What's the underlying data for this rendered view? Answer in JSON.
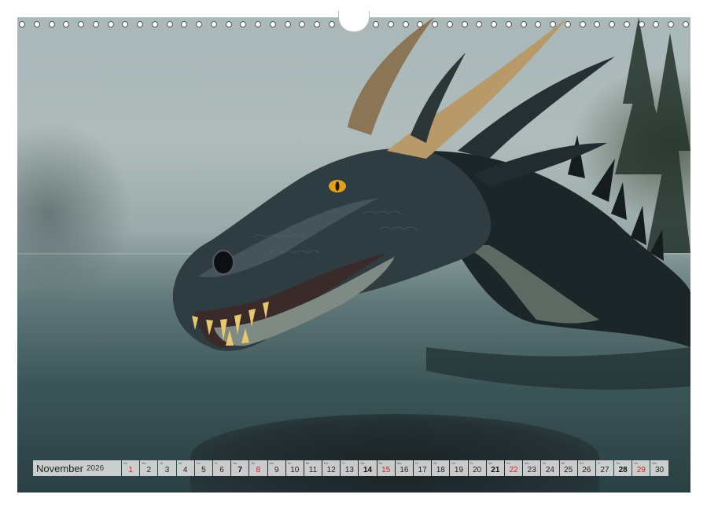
{
  "calendar": {
    "month": "November",
    "year": "2026",
    "days": [
      {
        "num": "1",
        "wd": "So",
        "type": "sun"
      },
      {
        "num": "2",
        "wd": "Mo",
        "type": ""
      },
      {
        "num": "3",
        "wd": "Di",
        "type": ""
      },
      {
        "num": "4",
        "wd": "Mi",
        "type": ""
      },
      {
        "num": "5",
        "wd": "Do",
        "type": ""
      },
      {
        "num": "6",
        "wd": "Fr",
        "type": ""
      },
      {
        "num": "7",
        "wd": "Sa",
        "type": "sat"
      },
      {
        "num": "8",
        "wd": "So",
        "type": "sun"
      },
      {
        "num": "9",
        "wd": "Mo",
        "type": ""
      },
      {
        "num": "10",
        "wd": "Di",
        "type": ""
      },
      {
        "num": "11",
        "wd": "Mi",
        "type": ""
      },
      {
        "num": "12",
        "wd": "Do",
        "type": ""
      },
      {
        "num": "13",
        "wd": "Fr",
        "type": ""
      },
      {
        "num": "14",
        "wd": "Sa",
        "type": "sat"
      },
      {
        "num": "15",
        "wd": "So",
        "type": "sun"
      },
      {
        "num": "16",
        "wd": "Mo",
        "type": ""
      },
      {
        "num": "17",
        "wd": "Di",
        "type": ""
      },
      {
        "num": "18",
        "wd": "Mi",
        "type": ""
      },
      {
        "num": "19",
        "wd": "Do",
        "type": ""
      },
      {
        "num": "20",
        "wd": "Fr",
        "type": ""
      },
      {
        "num": "21",
        "wd": "Sa",
        "type": "sat"
      },
      {
        "num": "22",
        "wd": "So",
        "type": "sun"
      },
      {
        "num": "23",
        "wd": "Mo",
        "type": ""
      },
      {
        "num": "24",
        "wd": "Di",
        "type": ""
      },
      {
        "num": "25",
        "wd": "Mi",
        "type": ""
      },
      {
        "num": "26",
        "wd": "Do",
        "type": ""
      },
      {
        "num": "27",
        "wd": "Fr",
        "type": ""
      },
      {
        "num": "28",
        "wd": "Sa",
        "type": "sat"
      },
      {
        "num": "29",
        "wd": "So",
        "type": "sun"
      },
      {
        "num": "30",
        "wd": "Mo",
        "type": ""
      }
    ]
  },
  "colors": {
    "sunday": "#d02020",
    "strip_bg": "#e1e1e1"
  }
}
